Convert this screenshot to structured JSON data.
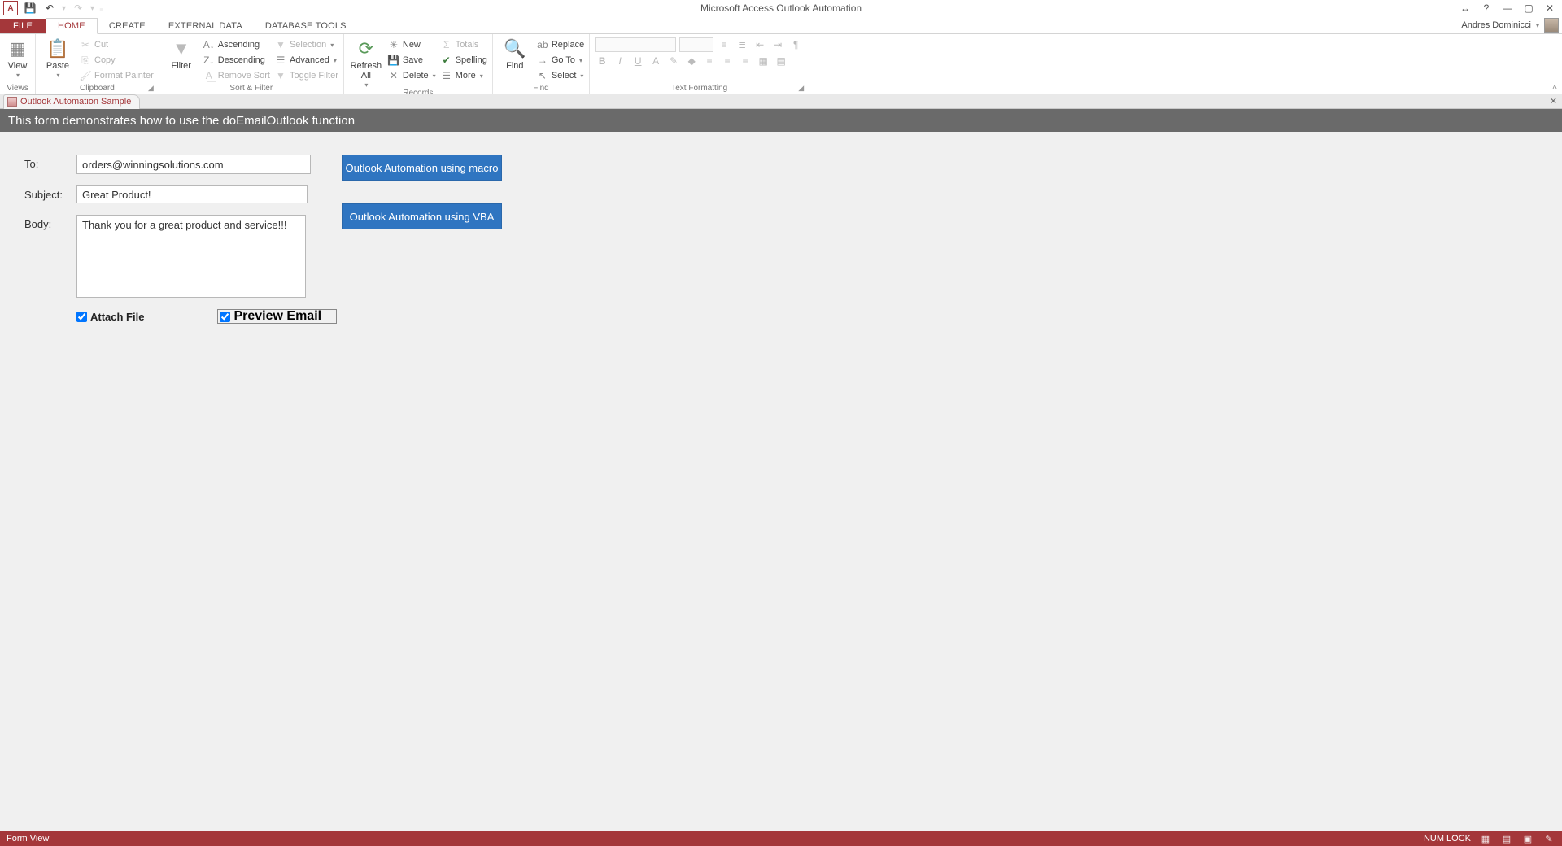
{
  "app": {
    "title": "Microsoft Access Outlook Automation",
    "file_tab": "FILE",
    "tabs": [
      "HOME",
      "CREATE",
      "EXTERNAL DATA",
      "DATABASE TOOLS"
    ],
    "active_tab": "HOME",
    "user": "Andres Dominicci"
  },
  "ribbon": {
    "views": {
      "label": "Views",
      "view": "View"
    },
    "clipboard": {
      "label": "Clipboard",
      "paste": "Paste",
      "cut": "Cut",
      "copy": "Copy",
      "fmt": "Format Painter"
    },
    "sortfilter": {
      "label": "Sort & Filter",
      "filter": "Filter",
      "asc": "Ascending",
      "desc": "Descending",
      "remove": "Remove Sort",
      "selection": "Selection",
      "advanced": "Advanced",
      "toggle": "Toggle Filter"
    },
    "records": {
      "label": "Records",
      "refresh": "Refresh All",
      "new": "New",
      "save": "Save",
      "delete": "Delete",
      "totals": "Totals",
      "spelling": "Spelling",
      "more": "More"
    },
    "find": {
      "label": "Find",
      "find": "Find",
      "replace": "Replace",
      "goto": "Go To",
      "select": "Select"
    },
    "textfmt": {
      "label": "Text Formatting"
    }
  },
  "doctab": {
    "title": "Outlook Automation Sample"
  },
  "form": {
    "header": "This form demonstrates how to use the doEmailOutlook function",
    "to_label": "To:",
    "to_value": "orders@winningsolutions.com",
    "subject_label": "Subject:",
    "subject_value": "Great Product!",
    "body_label": "Body:",
    "body_value": "Thank you for a great product and service!!!",
    "btn_macro": "Outlook Automation using macro",
    "btn_vba": "Outlook Automation using VBA",
    "attach_label": "Attach File",
    "preview_label": "Preview Email"
  },
  "status": {
    "left": "Form View",
    "numlock": "NUM LOCK"
  }
}
